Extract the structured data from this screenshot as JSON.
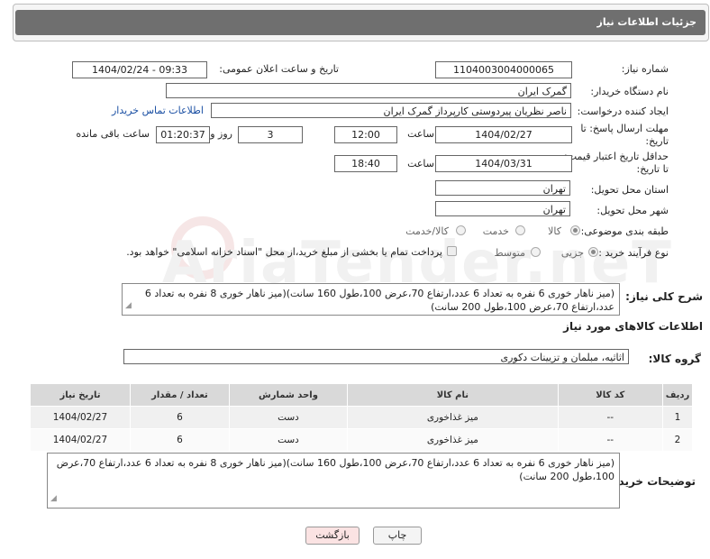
{
  "header": {
    "title": "جزئیات اطلاعات نیاز"
  },
  "fields": {
    "need_number_label": "شماره نیاز:",
    "need_number": "1104003004000065",
    "announce_label": "تاریخ و ساعت اعلان عمومی:",
    "announce_value": "1404/02/24 - 09:33",
    "buyer_org_label": "نام دستگاه خریدار:",
    "buyer_org": "گمرک ایران",
    "creator_label": "ایجاد کننده درخواست:",
    "creator": "ناصر نظریان پیردوستی کارپرداز گمرک ایران",
    "contact_link": "اطلاعات تماس خریدار",
    "deadline_label_1": "مهلت ارسال پاسخ: تا",
    "deadline_label_2": "تاریخ:",
    "deadline_date": "1404/02/27",
    "time_label": "ساعت",
    "deadline_time": "12:00",
    "days_value": "3",
    "days_label": "روز و",
    "remaining_value": "01:20:37",
    "remaining_label": "ساعت باقی مانده",
    "validity_label_1": "حداقل تاریخ اعتبار قیمت:",
    "validity_label_2": "تا تاریخ:",
    "validity_date": "1404/03/31",
    "validity_time": "18:40",
    "province_label": "استان محل تحویل:",
    "province": "تهران",
    "city_label": "شهر محل تحویل:",
    "city": "تهران",
    "category_label": "طبقه بندی موضوعی:",
    "category_options": [
      "کالا",
      "خدمت",
      "کالا/خدمت"
    ],
    "process_label": "نوع فرآیند خرید :",
    "process_options": [
      "جزیی",
      "متوسط"
    ],
    "payment_note": "پرداخت تمام یا بخشی از مبلغ خرید،از محل \"اسناد خزانه اسلامی\" خواهد بود."
  },
  "description": {
    "label": "شرح کلی نیاز:",
    "text": "(میز ناهار خوری 6 نفره به تعداد 6 عدد،ارتفاع 70،عرض 100،طول 160 سانت)(میز ناهار خوری 8 نفره به تعداد 6 عدد،ارتفاع 70،عرض 100،طول 200 سانت)"
  },
  "goods": {
    "section_title": "اطلاعات کالاهای مورد نیاز",
    "group_label": "گروه کالا:",
    "group_value": "اثاثیه، مبلمان و تزیینات دکوری",
    "columns": [
      "ردیف",
      "کد کالا",
      "نام کالا",
      "واحد شمارش",
      "تعداد / مقدار",
      "تاریخ نیاز"
    ],
    "rows": [
      [
        "1",
        "--",
        "میز غذاخوری",
        "دست",
        "6",
        "1404/02/27"
      ],
      [
        "2",
        "--",
        "میز غذاخوری",
        "دست",
        "6",
        "1404/02/27"
      ]
    ]
  },
  "buyer_notes": {
    "label": "توضیحات خریدار:",
    "text": "(میز ناهار خوری 6 نفره به تعداد 6 عدد،ارتفاع 70،عرض 100،طول 160 سانت)(میز ناهار خوری 8 نفره به تعداد 6 عدد،ارتفاع 70،عرض 100،طول 200 سانت)"
  },
  "buttons": {
    "print": "چاپ",
    "back": "بازگشت"
  }
}
